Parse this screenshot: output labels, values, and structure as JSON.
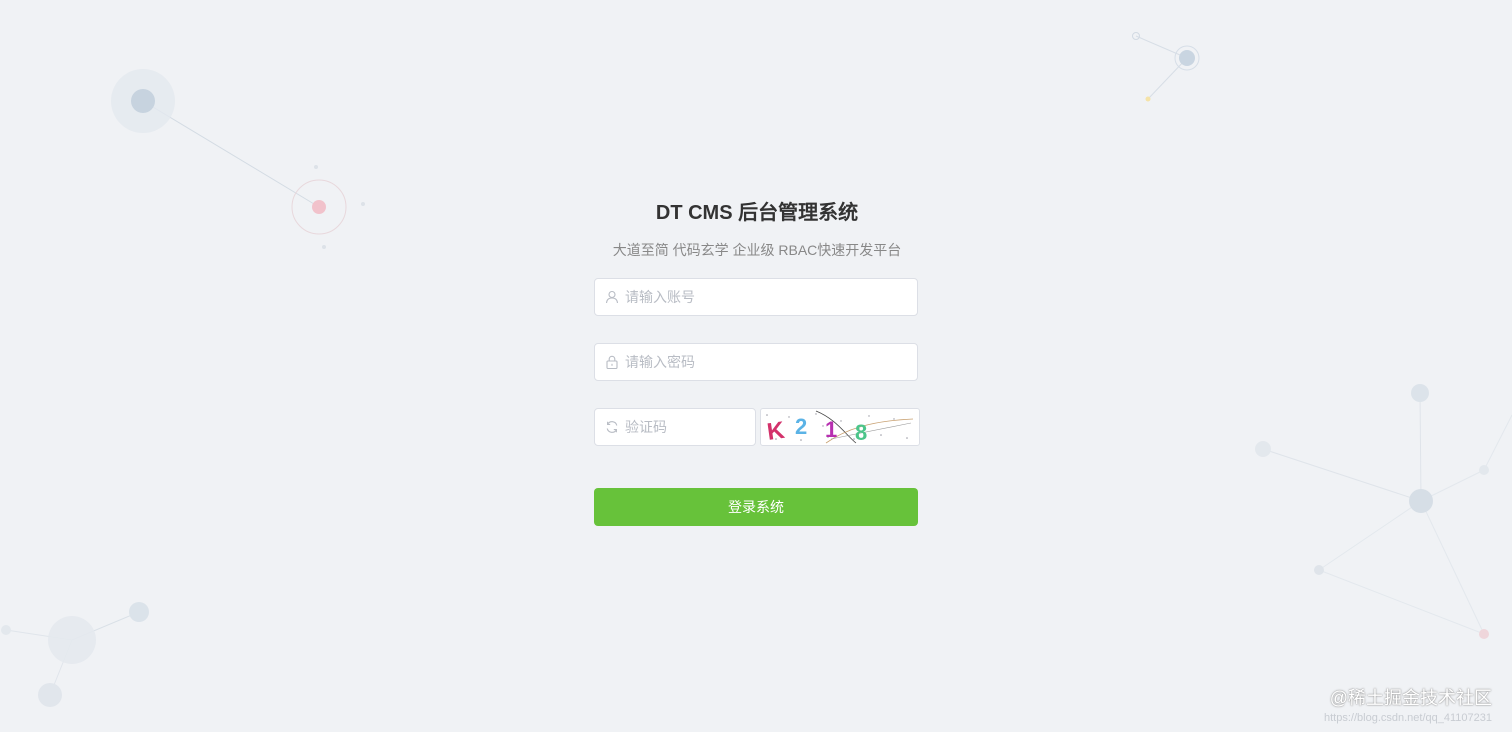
{
  "colors": {
    "background": "#f0f2f5",
    "primary_button": "#67c23a",
    "title": "#333333",
    "subtitle": "#888888",
    "placeholder": "#b8bcc4",
    "node_blue": "#c5d3e0",
    "node_pink": "#f1c2cb",
    "node_yellow": "#f5e3a8"
  },
  "login": {
    "title": "DT CMS 后台管理系统",
    "subtitle": "大道至简 代码玄学 企业级 RBAC快速开发平台",
    "username": {
      "placeholder": "请输入账号",
      "value": "",
      "icon": "user-icon"
    },
    "password": {
      "placeholder": "请输入密码",
      "value": "",
      "icon": "lock-icon"
    },
    "captcha": {
      "placeholder": "验证码",
      "value": "",
      "icon": "refresh-icon",
      "image_text": "K218"
    },
    "submit_label": "登录系统"
  },
  "watermark": {
    "label": "@稀土掘金技术社区",
    "url": "https://blog.csdn.net/qq_41107231"
  }
}
